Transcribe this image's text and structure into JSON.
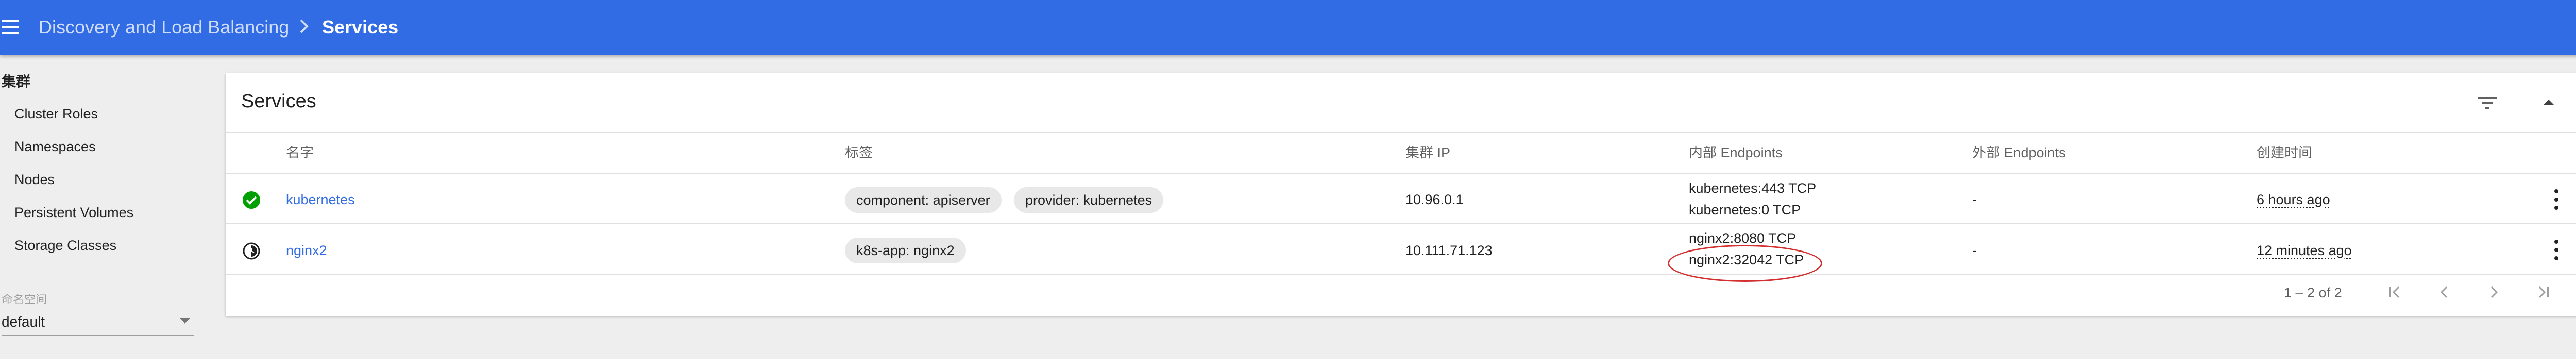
{
  "header": {
    "breadcrumb_parent": "Discovery and Load Balancing",
    "breadcrumb_current": "Services",
    "color": "#326ce5"
  },
  "sidebar": {
    "heading": "集群",
    "items": [
      {
        "label": "Cluster Roles"
      },
      {
        "label": "Namespaces"
      },
      {
        "label": "Nodes"
      },
      {
        "label": "Persistent Volumes"
      },
      {
        "label": "Storage Classes"
      }
    ],
    "namespace_label": "命名空间",
    "namespace_value": "default"
  },
  "card": {
    "title": "Services",
    "columns": [
      "名字",
      "标签",
      "集群 IP",
      "内部 Endpoints",
      "外部 Endpoints",
      "创建时间"
    ],
    "rows": [
      {
        "status": "ok",
        "status_icon": "check-circle-icon",
        "name": "kubernetes",
        "labels": [
          "component: apiserver",
          "provider: kubernetes"
        ],
        "cluster_ip": "10.96.0.1",
        "internal_endpoints": [
          "kubernetes:443 TCP",
          "kubernetes:0 TCP"
        ],
        "external_endpoints": "-",
        "created": "6 hours ago"
      },
      {
        "status": "pending",
        "status_icon": "pending-circle-icon",
        "name": "nginx2",
        "labels": [
          "k8s-app: nginx2"
        ],
        "cluster_ip": "10.111.71.123",
        "internal_endpoints": [
          "nginx2:8080 TCP",
          "nginx2:32042 TCP"
        ],
        "external_endpoints": "-",
        "created": "12 minutes ago"
      }
    ],
    "pagination": {
      "range": "1 – 2 of 2"
    }
  },
  "colors": {
    "accent": "#326ce5",
    "success": "#00a000",
    "annotation": "#d32f2f"
  }
}
